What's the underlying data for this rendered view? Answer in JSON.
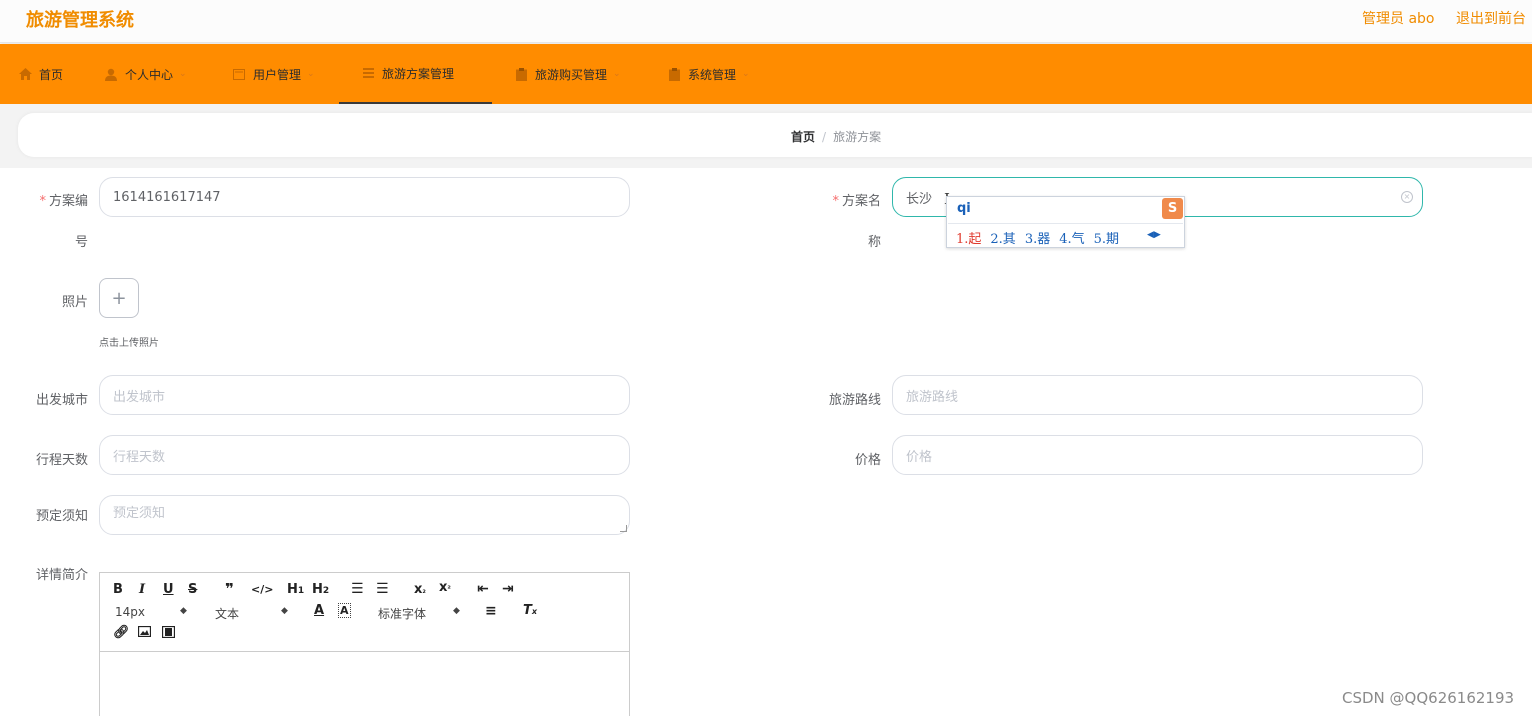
{
  "header": {
    "app_title": "旅游管理系统",
    "user": "管理员 abo",
    "logout": "退出到前台"
  },
  "nav": [
    {
      "label": "首页",
      "icon": "home-icon"
    },
    {
      "label": "个人中心",
      "icon": "user-icon"
    },
    {
      "label": "用户管理",
      "icon": "doc-icon"
    },
    {
      "label": "旅游方案管理",
      "icon": "list-icon",
      "active": true
    },
    {
      "label": "旅游购买管理",
      "icon": "clipboard-icon"
    },
    {
      "label": "系统管理",
      "icon": "clipboard-icon"
    }
  ],
  "breadcrumb": {
    "home": "首页",
    "separator": "/",
    "current": "旅游方案"
  },
  "form": {
    "plan_no_label": "方案编\n号",
    "plan_no_label_1": "方案编",
    "plan_no_label_2": "号",
    "plan_no_value": "1614161617147",
    "plan_name_label_1": "方案名",
    "plan_name_label_2": "称",
    "plan_name_value": "长沙",
    "photo_label": "照片",
    "upload_plus": "+",
    "upload_tip": "点击上传照片",
    "depart_city_label": "出发城市",
    "depart_city_placeholder": "出发城市",
    "route_label": "旅游路线",
    "route_placeholder": "旅游路线",
    "days_label": "行程天数",
    "days_placeholder": "行程天数",
    "price_label": "价格",
    "price_placeholder": "价格",
    "notice_label": "预定须知",
    "notice_placeholder": "预定须知",
    "detail_label": "详情简介"
  },
  "editor": {
    "size": "14px",
    "header": "文本",
    "font": "标准字体"
  },
  "ime": {
    "pinyin": "qi",
    "logo": "S",
    "candidates": [
      "1.起",
      "2.其",
      "3.器",
      "4.气",
      "5.期"
    ]
  },
  "watermark": "CSDN @QQ626162193",
  "colors": {
    "accent": "#ff8c00",
    "title": "#f08c00",
    "focus": "#2fb7ab"
  }
}
